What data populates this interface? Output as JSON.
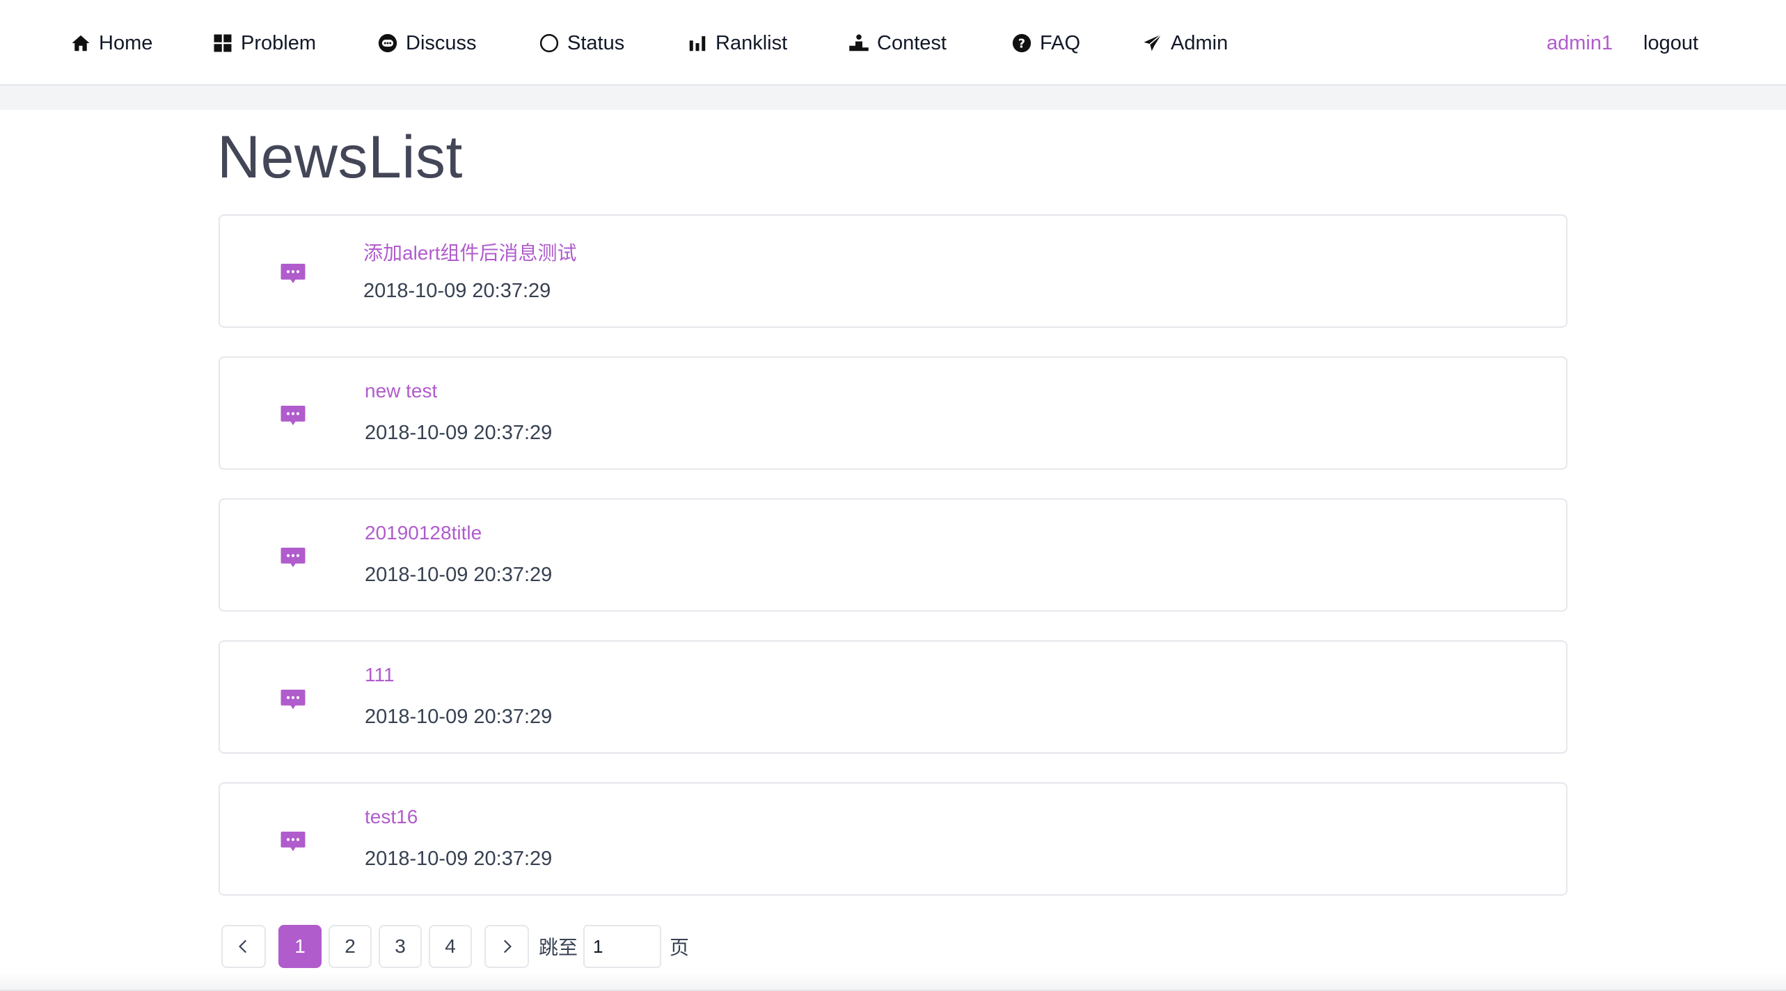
{
  "nav": {
    "items": [
      {
        "label": "Home",
        "icon": "home-icon"
      },
      {
        "label": "Problem",
        "icon": "grid-icon"
      },
      {
        "label": "Discuss",
        "icon": "chat-icon"
      },
      {
        "label": "Status",
        "icon": "circle-icon"
      },
      {
        "label": "Ranklist",
        "icon": "bar-chart-icon"
      },
      {
        "label": "Contest",
        "icon": "podium-icon"
      },
      {
        "label": "FAQ",
        "icon": "question-icon"
      },
      {
        "label": "Admin",
        "icon": "paper-plane-icon"
      }
    ],
    "username": "admin1",
    "logout_label": "logout"
  },
  "page": {
    "title": "NewsList"
  },
  "news": [
    {
      "title": "添加alert组件后消息测试",
      "date": "2018-10-09 20:37:29",
      "icon": "message-icon"
    },
    {
      "title": "new test",
      "date": "2018-10-09 20:37:29",
      "icon": "message-icon"
    },
    {
      "title": "20190128title",
      "date": "2018-10-09 20:37:29",
      "icon": "message-icon"
    },
    {
      "title": "111",
      "date": "2018-10-09 20:37:29",
      "icon": "message-icon"
    },
    {
      "title": "test16",
      "date": "2018-10-09 20:37:29",
      "icon": "message-icon"
    }
  ],
  "pagination": {
    "pages": [
      "1",
      "2",
      "3",
      "4"
    ],
    "current": "1",
    "jump_label": "跳至",
    "jump_value": "1",
    "page_unit": "页",
    "prev_icon": "chevron-left-icon",
    "next_icon": "chevron-right-icon"
  },
  "colors": {
    "accent": "#b05ccc",
    "title": "#424657",
    "border": "#e5e7eb"
  }
}
